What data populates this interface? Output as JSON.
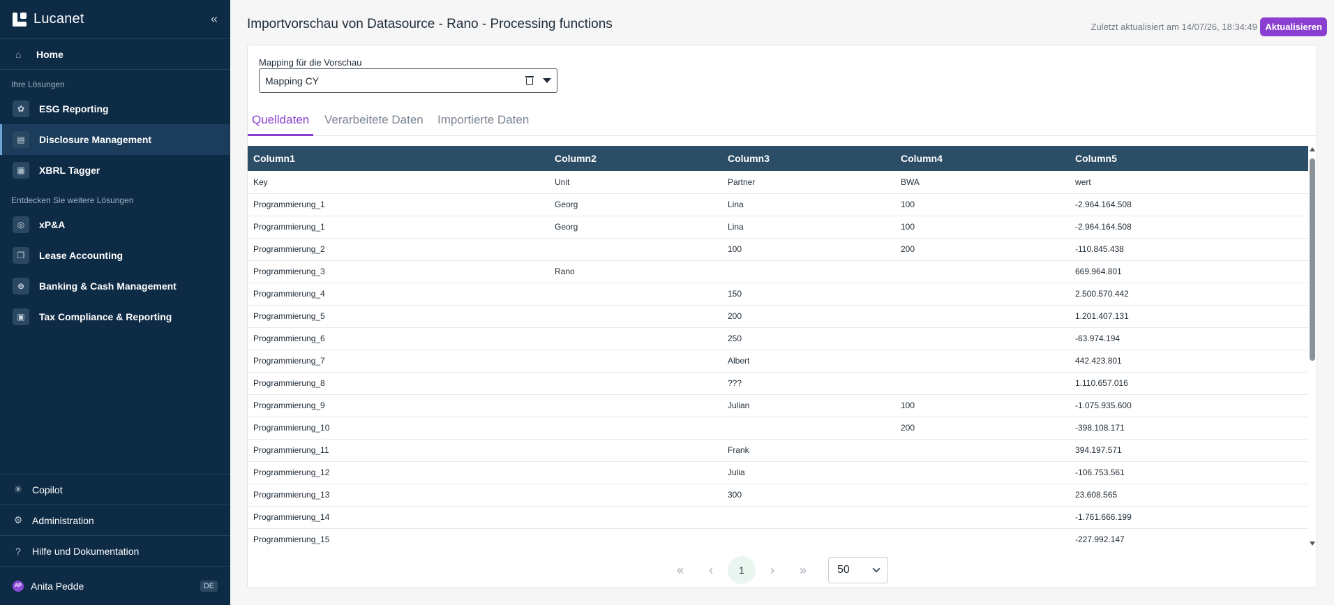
{
  "sidebar": {
    "brand": "Lucanet",
    "home_label": "Home",
    "solutions_label": "Ihre Lösungen",
    "solutions": [
      {
        "label": "ESG Reporting",
        "icon": "leaf-icon",
        "glyph": "✿"
      },
      {
        "label": "Disclosure Management",
        "icon": "chat-report-icon",
        "glyph": "▤"
      },
      {
        "label": "XBRL Tagger",
        "icon": "document-tag-icon",
        "glyph": "▦"
      }
    ],
    "discover_label": "Entdecken Sie weitere Lösungen",
    "discover": [
      {
        "label": "xP&A",
        "icon": "circle-arrow-icon",
        "glyph": "◎"
      },
      {
        "label": "Lease Accounting",
        "icon": "documents-icon",
        "glyph": "❐"
      },
      {
        "label": "Banking & Cash Management",
        "icon": "cash-icon",
        "glyph": "⊜"
      },
      {
        "label": "Tax Compliance & Reporting",
        "icon": "tax-document-icon",
        "glyph": "▣"
      }
    ],
    "bottom": {
      "copilot": "Copilot",
      "administration": "Administration",
      "help": "Hilfe und Dokumentation"
    },
    "user": {
      "initials": "AP",
      "name": "Anita Pedde",
      "language": "DE"
    }
  },
  "header": {
    "title": "Importvorschau von Datasource - Rano - Processing functions",
    "last_updated": "Zuletzt aktualisiert am 14/07/26, 18:34:49",
    "refresh_label": "Aktualisieren"
  },
  "mapping": {
    "label": "Mapping für die Vorschau",
    "value": "Mapping CY"
  },
  "tabs": [
    {
      "label": "Quelldaten",
      "active": true
    },
    {
      "label": "Verarbeitete Daten",
      "active": false
    },
    {
      "label": "Importierte Daten",
      "active": false
    }
  ],
  "table": {
    "columns": [
      "Column1",
      "Column2",
      "Column3",
      "Column4",
      "Column5"
    ],
    "rows": [
      [
        "Key",
        "Unit",
        "Partner",
        "BWA",
        "wert"
      ],
      [
        "Programmierung_1",
        "Georg",
        "Lina",
        "100",
        "-2.964.164.508"
      ],
      [
        "Programmierung_1",
        "Georg",
        "Lina",
        "100",
        "-2.964.164.508"
      ],
      [
        "Programmierung_2",
        "",
        "100",
        "200",
        "-110.845.438"
      ],
      [
        "Programmierung_3",
        "Rano",
        "",
        "",
        "669.964.801"
      ],
      [
        "Programmierung_4",
        "",
        "150",
        "",
        "2.500.570.442"
      ],
      [
        "Programmierung_5",
        "",
        "200",
        "",
        "1.201.407.131"
      ],
      [
        "Programmierung_6",
        "",
        "250",
        "",
        "-63.974.194"
      ],
      [
        "Programmierung_7",
        "",
        "Albert",
        "",
        "442.423.801"
      ],
      [
        "Programmierung_8",
        "",
        "???",
        "",
        "1.110.657.016"
      ],
      [
        "Programmierung_9",
        "",
        "Julian",
        "100",
        "-1.075.935.600"
      ],
      [
        "Programmierung_10",
        "",
        "",
        "200",
        "-398.108.171"
      ],
      [
        "Programmierung_11",
        "",
        "Frank",
        "",
        "394.197.571"
      ],
      [
        "Programmierung_12",
        "",
        "Julia",
        "",
        "-106.753.561"
      ],
      [
        "Programmierung_13",
        "",
        "300",
        "",
        "23.608.565"
      ],
      [
        "Programmierung_14",
        "",
        "",
        "",
        "-1.761.666.199"
      ],
      [
        "Programmierung_15",
        "",
        "",
        "",
        "-227.992.147"
      ]
    ]
  },
  "pagination": {
    "first": "«",
    "prev": "‹",
    "current_page": "1",
    "next": "›",
    "last": "»",
    "page_size": "50"
  },
  "colors": {
    "sidebar_bg": "#0d2b45",
    "accent": "#8a3fd1",
    "table_header": "#2b4d66"
  }
}
